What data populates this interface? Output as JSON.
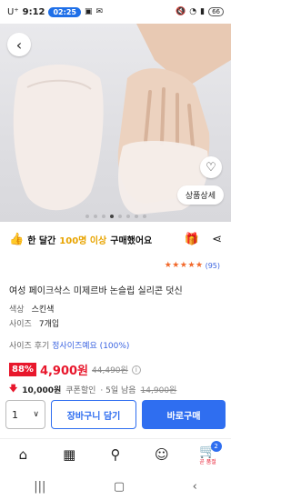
{
  "status_bar": {
    "network": "U⁺",
    "time": "9:12",
    "call_pill": "02:25",
    "battery": "66"
  },
  "hero": {
    "detail_button": "상품상세"
  },
  "promo": {
    "emoji": "👍",
    "text_a": "한 달간",
    "text_highlight": "100명 이상",
    "text_b": "구매했어요"
  },
  "rating": {
    "stars": "★★★★★",
    "count": "(95)"
  },
  "product": {
    "title": "여성 페이크삭스 미제르바 논슬립 실리콘 덧신",
    "color_key": "색상",
    "color_value": "스킨색",
    "size_key": "사이즈",
    "size_value": "7개입"
  },
  "review": {
    "prefix": "사이즈 후기",
    "value": "정사이즈예요 (100%)"
  },
  "price": {
    "discount": "88%",
    "current": "4,900원",
    "original": "44,490원",
    "info_icon": "i"
  },
  "coupon": {
    "amount": "10,000원",
    "label": "쿠폰할인",
    "days": "· 5일 남음",
    "original": "14,900원"
  },
  "actions": {
    "qty": "1",
    "qty_chevron": "∨",
    "cart": "장바구니 담기",
    "buy": "바로구매"
  },
  "bottom_nav": {
    "cart_badge": "2",
    "cart_label": "곧 품절"
  }
}
